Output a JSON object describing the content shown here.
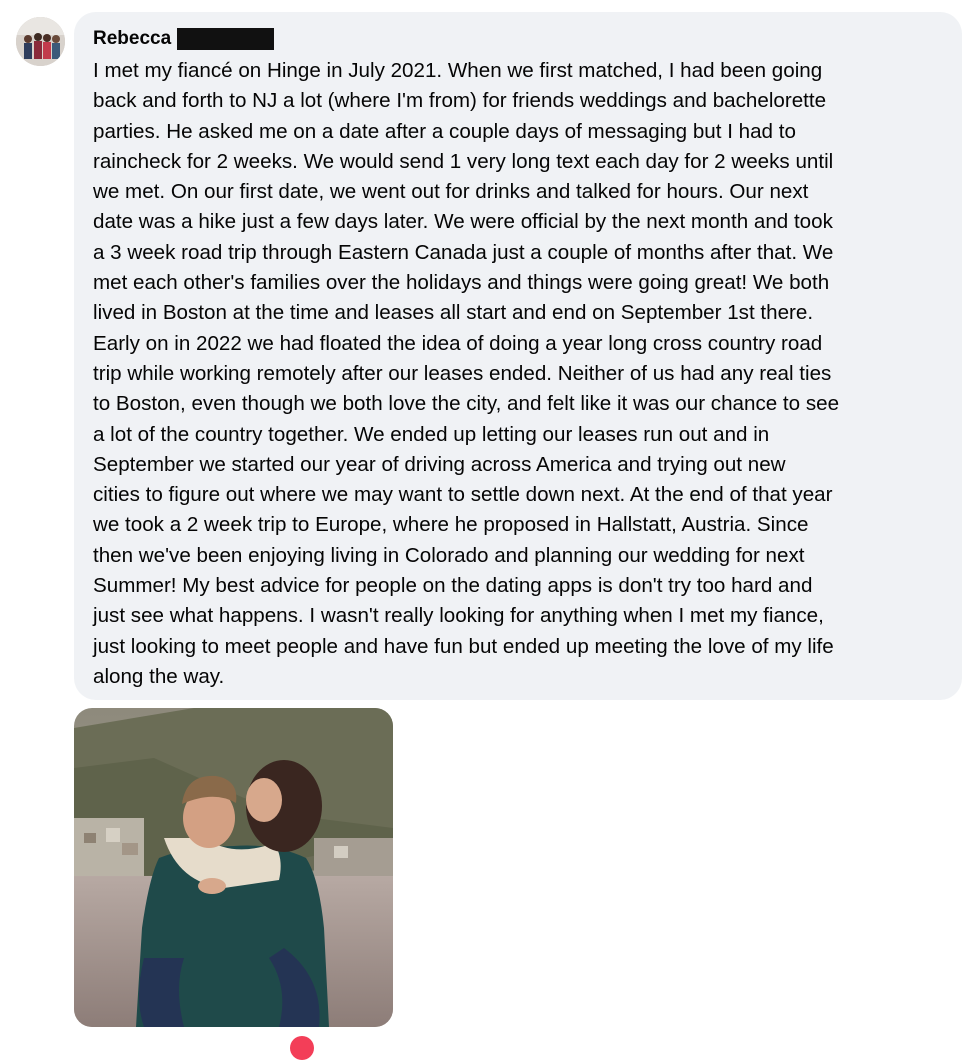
{
  "comment": {
    "author": "Rebecca",
    "body": "I met my fiancé on Hinge in July 2021. When we first matched, I had been going\nback and forth to NJ a lot (where I'm from) for friends weddings and bachelorette\nparties. He asked me on a date after a couple days of messaging but I had to\nraincheck for 2 weeks. We would send 1 very long text each day for 2 weeks until\nwe met. On our first date, we went out for drinks and talked for hours. Our next\ndate was a hike just a few days later. We were official by the next month and took\na 3 week road trip through Eastern Canada just a couple of months after that. We\nmet each other's families over the holidays and things were going great! We both\nlived in Boston at the time and leases all start and end on September 1st there.\nEarly on in 2022 we had floated the idea of doing a year long cross country road\ntrip while working remotely after our leases ended. Neither of us had any real ties\nto Boston, even though we both love the city, and felt like it was our chance to see\na lot of the country together. We ended up letting our leases run out and in\nSeptember we started our year of driving across America and trying out new\ncities to figure out where we may want to settle down next. At the end of that year\nwe took a 2 week trip to Europe, where he proposed in Hallstatt, Austria. Since\nthen we've been enjoying living in Colorado and planning our wedding for next\nSummer! My best advice for people on the dating apps is don't try too hard and\njust see what happens. I wasn't really looking for anything when I met my fiance,\njust looking to meet people and have fun but ended up meeting the love of my life\nalong the way."
  },
  "colors": {
    "bubble": "#f0f2f5",
    "text": "#050505",
    "redaction": "#111111",
    "reaction": "#f33e58"
  },
  "icons": {
    "avatar": "profile-photo",
    "reaction": "heart-reaction-icon"
  }
}
